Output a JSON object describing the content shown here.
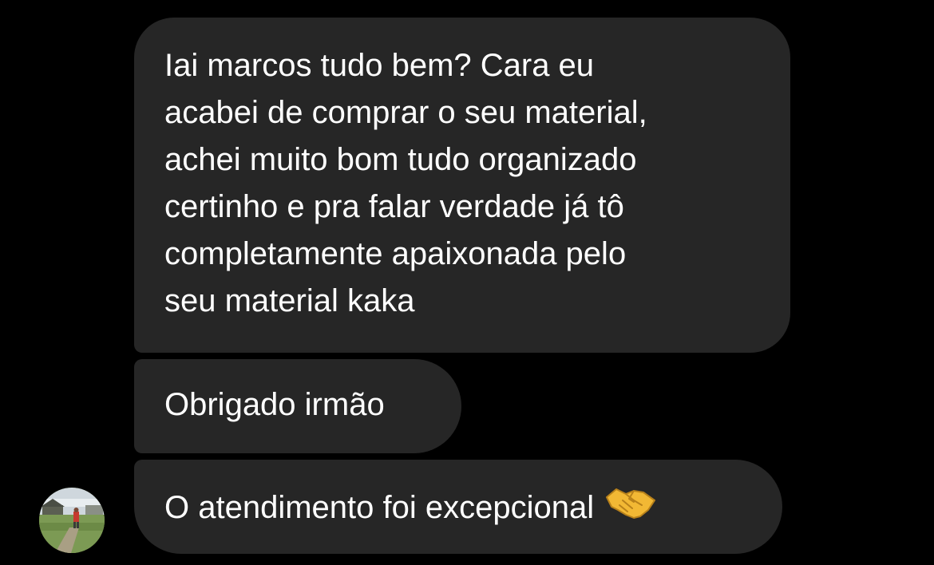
{
  "chat": {
    "messages": [
      {
        "lines": [
          "Iai marcos tudo bem? Cara eu",
          "acabei de comprar o seu material,",
          "achei muito bom tudo organizado",
          "certinho e pra falar verdade já tô",
          "completamente apaixonada pelo",
          "seu material kaka"
        ]
      },
      {
        "lines": [
          "Obrigado irmão"
        ]
      },
      {
        "lines": [
          "O atendimento foi excepcional"
        ],
        "emoji": "handshake-icon"
      }
    ],
    "colors": {
      "background": "#000000",
      "bubble": "#262626",
      "text": "#ffffff",
      "emoji": "#f2b834"
    },
    "avatar": {
      "icon": "contact-avatar"
    }
  }
}
